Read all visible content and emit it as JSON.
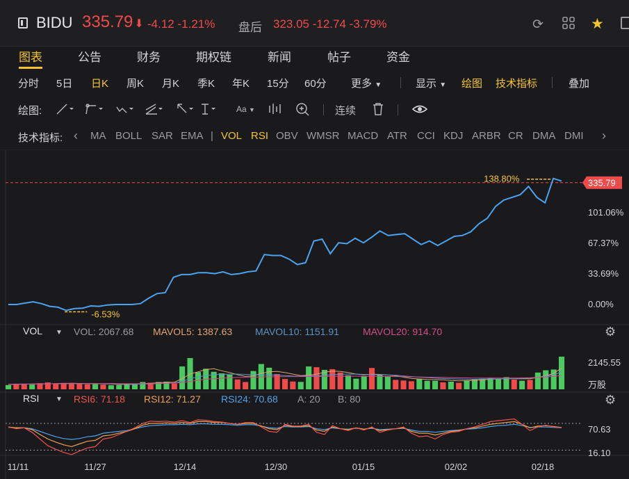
{
  "header": {
    "symbol": "BIDU",
    "price": "335.79",
    "price_arrow": "⬇",
    "change": "-4.12",
    "change_pct": "-1.21%",
    "after_hours_label": "盘后",
    "after_hours_price": "323.05",
    "after_hours_change": "-12.74",
    "after_hours_pct": "-3.79%",
    "icons": [
      "refresh-icon",
      "grid-icon",
      "star-icon"
    ]
  },
  "tabs": [
    "图表",
    "公告",
    "财务",
    "期权链",
    "新闻",
    "帖子",
    "资金"
  ],
  "active_tab": "图表",
  "periods": [
    "分时",
    "5日",
    "日K",
    "周K",
    "月K",
    "季K",
    "年K",
    "15分",
    "60分"
  ],
  "active_period": "日K",
  "more_label": "更多",
  "display_label": "显示",
  "draw_label": "绘图",
  "indicators_label": "技术指标",
  "overlay_label": "叠加",
  "draw_toolbar": {
    "label": "绘图:",
    "aa_label": "Aa",
    "continuous_label": "连续"
  },
  "indicator_bar": {
    "label": "技术指标:",
    "items": [
      "MA",
      "BOLL",
      "SAR",
      "EMA",
      "VOL",
      "RSI",
      "OBV",
      "WMSR",
      "MACD",
      "ATR",
      "CCI",
      "KDJ",
      "ARBR",
      "CR",
      "DMA",
      "DMI"
    ],
    "active": [
      "VOL",
      "RSI"
    ]
  },
  "colors": {
    "up": "#ef4b4b",
    "down": "#4cc960",
    "line": "#4aa3f0",
    "accent": "#f4c430",
    "mavol5": "#e0a374",
    "mavol10": "#5a93c8",
    "mavol20": "#d14d8a",
    "rsi6": "#ef5350",
    "rsi12": "#f0a04a",
    "rsi24": "#4aa3f0"
  },
  "chart_data": {
    "type": "line",
    "x_labels": [
      "11/11",
      "11/27",
      "12/14",
      "12/30",
      "01/15",
      "02/02",
      "02/18"
    ],
    "y_ticks": [
      "101.06%",
      "67.37%",
      "33.69%",
      "0.00%"
    ],
    "last_price_label": "335.79",
    "max_label": "138.80%",
    "min_label": "-6.53%",
    "price_pct": [
      0,
      0,
      1.5,
      3,
      1,
      -2,
      -3,
      -6.53,
      -4.5,
      -4,
      -1.5,
      -2,
      -0.5,
      0,
      0,
      0,
      1,
      7,
      12,
      13,
      30,
      33,
      33,
      35,
      35,
      34,
      36,
      33,
      34,
      36,
      37,
      55,
      54,
      54,
      50,
      44,
      46,
      70,
      72,
      56,
      68,
      67,
      73,
      68,
      74,
      81,
      76,
      77,
      78,
      72,
      66,
      70,
      65,
      70,
      75,
      76,
      80,
      89,
      95,
      108,
      115,
      118,
      121,
      130,
      118,
      112,
      138.8,
      136
    ],
    "volume": {
      "title": "VOL",
      "vol_label": "VOL: 2067.68",
      "mavol5_label": "MAVOL5: 1387.63",
      "mavol10_label": "MAVOL10: 1151.91",
      "mavol20_label": "MAVOL20: 914.70",
      "top_label": "2145.55",
      "unit_label": "万股",
      "values": [
        280,
        350,
        330,
        310,
        400,
        450,
        380,
        420,
        360,
        390,
        330,
        340,
        310,
        270,
        290,
        300,
        360,
        480,
        430,
        480,
        500,
        380,
        1500,
        2050,
        1130,
        1350,
        1150,
        1050,
        960,
        650,
        480,
        1200,
        1660,
        1420,
        1000,
        680,
        510,
        490,
        1500,
        1450,
        1280,
        1320,
        1100,
        920,
        700,
        860,
        1400,
        960,
        820,
        620,
        580,
        530,
        700,
        560,
        560,
        460,
        500,
        430,
        600,
        640,
        700,
        760,
        660,
        800,
        640,
        560,
        620,
        1100,
        1250,
        1300,
        2145
      ],
      "up": [
        0,
        1,
        1,
        0,
        1,
        1,
        1,
        1,
        1,
        1,
        1,
        0,
        1,
        0,
        0,
        0,
        0,
        0,
        1,
        0,
        0,
        1,
        0,
        0,
        0,
        0,
        0,
        0,
        0,
        1,
        1,
        0,
        0,
        0,
        1,
        1,
        1,
        0,
        0,
        1,
        0,
        1,
        1,
        0,
        0,
        0,
        1,
        0,
        0,
        1,
        1,
        1,
        0,
        0,
        0,
        1,
        0,
        1,
        0,
        0,
        0,
        0,
        0,
        0,
        1,
        0,
        1,
        0,
        0,
        0,
        0
      ],
      "mavol5": [
        320,
        330,
        340,
        345,
        350,
        360,
        375,
        390,
        395,
        390,
        380,
        370,
        360,
        345,
        330,
        320,
        330,
        370,
        400,
        430,
        460,
        470,
        700,
        1000,
        1150,
        1300,
        1350,
        1220,
        1100,
        960,
        850,
        880,
        1050,
        1150,
        1180,
        1100,
        1000,
        900,
        920,
        1000,
        1120,
        1200,
        1180,
        1100,
        1000,
        950,
        990,
        980,
        940,
        890,
        800,
        720,
        680,
        650,
        640,
        620,
        580,
        560,
        570,
        590,
        620,
        660,
        680,
        700,
        700,
        690,
        700,
        780,
        880,
        1050,
        1387
      ],
      "mavol10": [
        330,
        335,
        340,
        345,
        350,
        360,
        370,
        375,
        380,
        385,
        380,
        375,
        370,
        365,
        355,
        345,
        340,
        345,
        360,
        380,
        400,
        420,
        520,
        700,
        820,
        900,
        960,
        980,
        1000,
        1000,
        980,
        960,
        950,
        940,
        930,
        900,
        870,
        860,
        870,
        890,
        920,
        960,
        990,
        1000,
        1000,
        980,
        970,
        960,
        940,
        920,
        880,
        840,
        800,
        770,
        740,
        710,
        690,
        670,
        660,
        660,
        670,
        680,
        690,
        700,
        710,
        720,
        740,
        780,
        850,
        950,
        1152
      ],
      "mavol20": [
        340,
        345,
        350,
        350,
        355,
        360,
        365,
        370,
        375,
        380,
        380,
        380,
        378,
        375,
        372,
        370,
        368,
        370,
        375,
        385,
        395,
        405,
        450,
        520,
        600,
        660,
        700,
        730,
        760,
        780,
        790,
        800,
        810,
        820,
        830,
        835,
        838,
        840,
        842,
        845,
        850,
        855,
        860,
        862,
        865,
        860,
        855,
        850,
        845,
        840,
        830,
        820,
        810,
        800,
        790,
        780,
        770,
        760,
        752,
        745,
        740,
        738,
        738,
        740,
        745,
        750,
        760,
        780,
        810,
        850,
        915
      ]
    },
    "rsi": {
      "title": "RSI",
      "rsi6_label": "RSI6: 71.18",
      "rsi12_label": "RSI12: 71.27",
      "rsi24_label": "RSI24: 70.68",
      "a_label": "A: 20",
      "b_label": "B: 80",
      "a": 20,
      "b": 80,
      "tick_top": "70.63",
      "tick_bottom": "16.10",
      "rsi6": [
        72,
        68,
        70,
        60,
        45,
        30,
        22,
        15,
        10,
        18,
        25,
        28,
        45,
        48,
        55,
        62,
        70,
        80,
        85,
        84,
        85,
        83,
        86,
        82,
        88,
        87,
        84,
        83,
        80,
        78,
        82,
        82,
        72,
        62,
        60,
        78,
        74,
        74,
        78,
        60,
        55,
        75,
        68,
        64,
        70,
        65,
        72,
        60,
        65,
        68,
        72,
        58,
        50,
        52,
        45,
        55,
        60,
        62,
        68,
        72,
        78,
        84,
        86,
        88,
        90,
        78,
        64,
        72,
        76,
        72,
        71
      ],
      "rsi12": [
        72,
        70,
        70,
        66,
        55,
        45,
        38,
        32,
        28,
        34,
        40,
        42,
        52,
        54,
        58,
        62,
        68,
        76,
        80,
        80,
        81,
        80,
        82,
        80,
        84,
        84,
        82,
        82,
        80,
        78,
        80,
        80,
        74,
        68,
        66,
        76,
        73,
        73,
        75,
        65,
        62,
        72,
        68,
        66,
        70,
        67,
        70,
        64,
        66,
        68,
        70,
        62,
        58,
        58,
        54,
        58,
        62,
        64,
        68,
        70,
        74,
        78,
        80,
        82,
        84,
        78,
        70,
        74,
        75,
        73,
        71
      ],
      "rsi24": [
        71,
        70,
        70,
        68,
        62,
        56,
        50,
        46,
        44,
        46,
        50,
        52,
        58,
        60,
        62,
        64,
        68,
        72,
        75,
        76,
        77,
        77,
        78,
        77,
        79,
        79,
        78,
        78,
        77,
        76,
        77,
        77,
        74,
        70,
        69,
        73,
        72,
        72,
        73,
        68,
        66,
        70,
        68,
        67,
        69,
        67,
        69,
        66,
        67,
        68,
        69,
        65,
        62,
        62,
        60,
        62,
        64,
        65,
        67,
        68,
        70,
        73,
        75,
        76,
        78,
        75,
        71,
        72,
        72,
        71,
        70
      ]
    }
  }
}
